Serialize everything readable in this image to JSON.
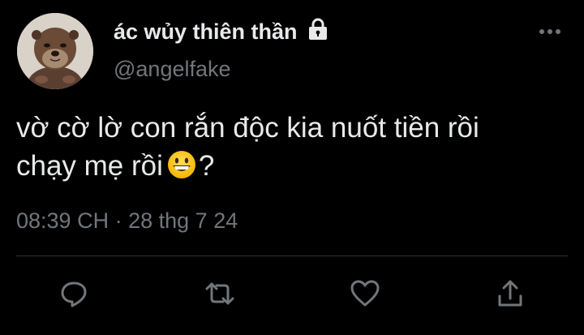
{
  "author": {
    "display_name": "ác wủy thiên thần",
    "handle": "@angelfake",
    "avatar_icon": "otter-avatar",
    "protected_icon": "lock-icon"
  },
  "tweet": {
    "text_line1": "vờ cờ lờ con rắn độc kia nuốt tiền rồi",
    "text_line2_before": "chạy mẹ rồi",
    "emoji_icon": "grinning-face-emoji",
    "text_line2_after": "?",
    "time": "08:39 CH",
    "separator": "·",
    "date": "28 thg 7 24"
  },
  "actions": {
    "reply_icon": "reply-icon",
    "retweet_icon": "retweet-icon",
    "like_icon": "heart-icon",
    "share_icon": "share-icon",
    "more_icon": "more-icon"
  },
  "colors": {
    "background": "#000000",
    "primary_text": "#e7e9ea",
    "secondary_text": "#71767b",
    "divider": "#2f3336"
  }
}
